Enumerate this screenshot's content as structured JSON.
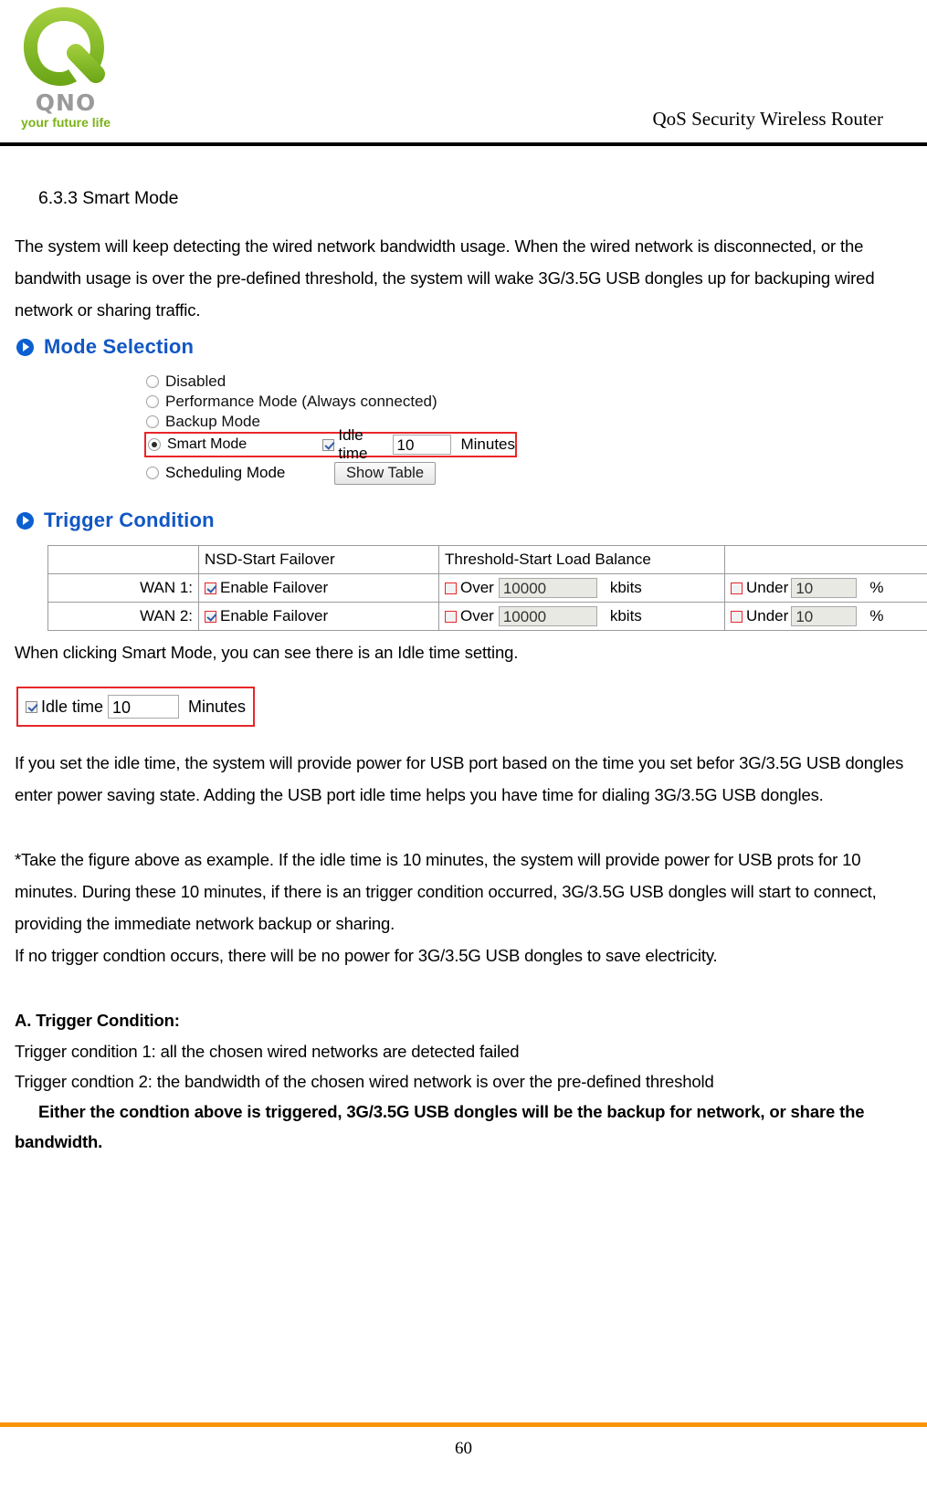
{
  "header": {
    "logo": {
      "mark": "qno-q-logo",
      "wordmark": "QNO",
      "tagline": "your future life"
    },
    "title": "QoS Security Wireless Router"
  },
  "document": {
    "section_heading": "6.3.3 Smart Mode",
    "intro_paragraph": "The system will keep detecting the wired network bandwidth usage.    When the wired network is disconnected, or the bandwith usage is over the pre-defined threshold, the system will wake 3G/3.5G USB dongles up for backuping wired network or sharing traffic.",
    "after_figure_1": "When clicking Smart Mode, you can see there is an Idle time setting.",
    "after_figure_2": "If you set the idle time, the system will provide power for USB port based on the time you set befor 3G/3.5G USB dongles enter power saving state.    Adding the USB port idle time helps you have time for dialing 3G/3.5G USB dongles.",
    "example_paragraph": "*Take the figure above as example. If the idle time is 10 minutes, the system will provide power for USB prots for 10 minutes.    During these 10 minutes, if there is an trigger condition occurred, 3G/3.5G USB dongles will start to connect, providing the immediate network backup or sharing.",
    "no_trigger_paragraph": "If no trigger condtion occurs, there will be no power for 3G/3.5G USB dongles to save electricity.",
    "trigger_heading": "A.    Trigger Condition:",
    "trigger_condition_1": "Trigger condition 1: all the chosen wired networks are detected failed",
    "trigger_condition_2": "Trigger condtion 2: the bandwidth of the chosen wired network is over the pre-defined threshold",
    "trigger_summary": "Either the condtion above is triggered, 3G/3.5G USB dongles will be the backup for network, or share the bandwidth."
  },
  "mode_selection": {
    "section_title": "Mode Selection",
    "options": [
      {
        "label": "Disabled",
        "selected": false
      },
      {
        "label": "Performance Mode (Always connected)",
        "selected": false
      },
      {
        "label": "Backup Mode",
        "selected": false
      },
      {
        "label": "Smart Mode",
        "selected": true
      },
      {
        "label": "Scheduling Mode",
        "selected": false
      }
    ],
    "idle_time": {
      "checkbox_checked": true,
      "label": "Idle time",
      "value": "10",
      "unit": "Minutes"
    },
    "show_table_button": "Show Table"
  },
  "trigger_condition": {
    "section_title": "Trigger Condition",
    "columns": [
      "",
      "NSD-Start Failover",
      "Threshold-Start Load Balance",
      ""
    ],
    "rows": [
      {
        "wan": "WAN 1:",
        "failover_label": "Enable Failover",
        "failover_checked": true,
        "over_label": "Over",
        "over_checked": false,
        "over_value": "10000",
        "over_unit": "kbits",
        "under_label": "Under",
        "under_checked": false,
        "under_value": "10",
        "under_unit": "%"
      },
      {
        "wan": "WAN 2:",
        "failover_label": "Enable Failover",
        "failover_checked": true,
        "over_label": "Over",
        "over_checked": false,
        "over_value": "10000",
        "over_unit": "kbits",
        "under_label": "Under",
        "under_checked": false,
        "under_value": "10",
        "under_unit": "%"
      }
    ]
  },
  "idle_time_figure": {
    "checkbox_checked": true,
    "label": "Idle time",
    "value": "10",
    "unit": "Minutes"
  },
  "footer": {
    "page_number": "60"
  },
  "colors": {
    "header_rule": "#000000",
    "footer_rule": "#fa9405",
    "ui_heading": "#1157c4",
    "highlight": "#e8262a",
    "logo_green": "#7ab317",
    "logo_gray": "#9a9a9a"
  }
}
